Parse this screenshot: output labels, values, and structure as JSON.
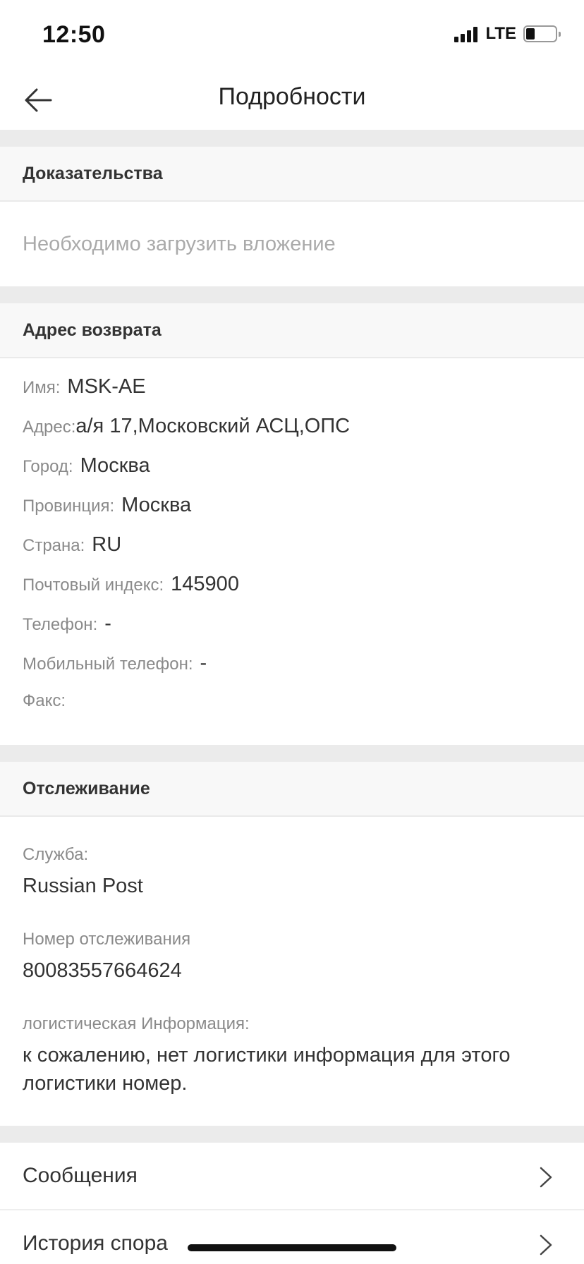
{
  "status_bar": {
    "time": "12:50",
    "network": "LTE",
    "battery_level": 0.3
  },
  "nav": {
    "title": "Подробности",
    "back_icon": "arrow-left-icon"
  },
  "evidence": {
    "header": "Доказательства",
    "placeholder": "Необходимо загрузить вложение"
  },
  "return_address": {
    "header": "Адрес возврата",
    "name_label": "Имя:",
    "name_value": "MSK-AE",
    "address_label": "Адрес:",
    "address_value": "а/я 17,Московский АСЦ,ОПС",
    "city_label": "Город:",
    "city_value": "Москва",
    "province_label": "Провинция:",
    "province_value": "Москва",
    "country_label": "Страна:",
    "country_value": "RU",
    "zip_label": "Почтовый индекс:",
    "zip_value": "145900",
    "phone_label": "Телефон:",
    "phone_value": "-",
    "mobile_label": "Мобильный телефон:",
    "mobile_value": "-",
    "fax_label": "Факс:",
    "fax_value": ""
  },
  "tracking": {
    "header": "Отслеживание",
    "service_label": "Служба:",
    "service_value": "Russian Post",
    "number_label": "Номер отслеживания",
    "number_value": "80083557664624",
    "logistics_label": "логистическая Информация:",
    "logistics_value": "к сожалению, нет логистики информация для этого логистики номер."
  },
  "menu": {
    "messages_label": "Сообщения",
    "dispute_history_label": "История спора",
    "chevron_icon": "chevron-right-icon"
  },
  "colors": {
    "section_gap": "#ebebeb",
    "header_bg": "#f8f8f8",
    "label_gray": "#8a8a8a",
    "text_dark": "#333333"
  }
}
